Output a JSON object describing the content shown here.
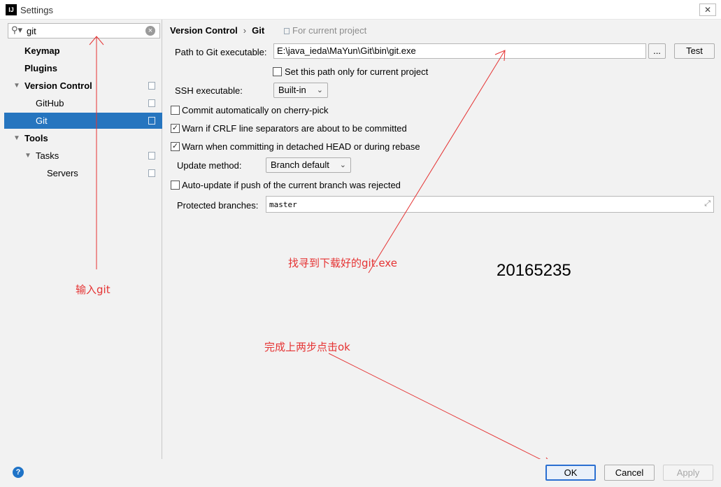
{
  "window": {
    "title": "Settings",
    "close_label": "✕",
    "app_icon_text": "IJ"
  },
  "search": {
    "value": "git",
    "clear_label": "×"
  },
  "sidebar": {
    "items": [
      {
        "label": "Keymap"
      },
      {
        "label": "Plugins"
      },
      {
        "label": "Version Control"
      },
      {
        "label": "GitHub"
      },
      {
        "label": "Git"
      },
      {
        "label": "Tools"
      },
      {
        "label": "Tasks"
      },
      {
        "label": "Servers"
      }
    ]
  },
  "breadcrumb": {
    "parent": "Version Control",
    "separator": "›",
    "current": "Git",
    "scope": "For current project"
  },
  "git_settings": {
    "path_label": "Path to Git executable:",
    "path_value": "E:\\java_ieda\\MaYun\\Git\\bin\\git.exe",
    "browse_label": "...",
    "test_label": "Test",
    "set_path_only": "Set this path only for current project",
    "ssh_label": "SSH executable:",
    "ssh_value": "Built-in",
    "commit_cherry_pick": "Commit automatically on cherry-pick",
    "warn_crlf": "Warn if CRLF line separators are about to be committed",
    "warn_detached": "Warn when committing in detached HEAD or during rebase",
    "update_method_label": "Update method:",
    "update_method_value": "Branch default",
    "auto_update": "Auto-update if push of the current branch was rejected",
    "protected_label": "Protected branches:",
    "protected_value": "master",
    "checked_mark": "✓"
  },
  "annotations": {
    "input_git": "输入git",
    "find_git_exe": "找寻到下载好的git.exe",
    "student_id": "20165235",
    "click_ok": "完成上两步点击ok",
    "color": "#e53333"
  },
  "footer": {
    "help_label": "?",
    "ok_label": "OK",
    "cancel_label": "Cancel",
    "apply_label": "Apply"
  },
  "colors": {
    "selection": "#2675bf",
    "accent": "#2a6fd1"
  }
}
